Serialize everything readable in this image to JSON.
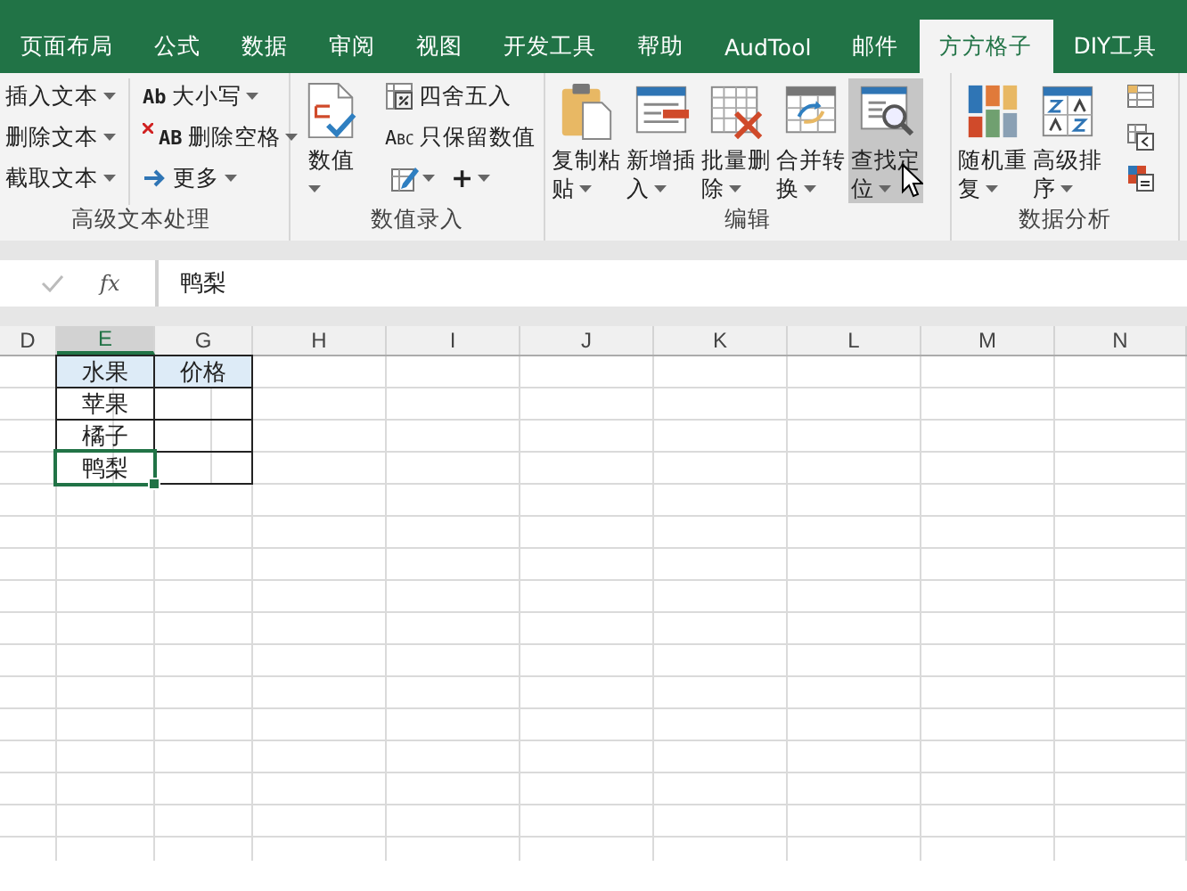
{
  "tabs": [
    {
      "label": "页面布局",
      "selected": false
    },
    {
      "label": "公式",
      "selected": false
    },
    {
      "label": "数据",
      "selected": false
    },
    {
      "label": "审阅",
      "selected": false
    },
    {
      "label": "视图",
      "selected": false
    },
    {
      "label": "开发工具",
      "selected": false
    },
    {
      "label": "帮助",
      "selected": false
    },
    {
      "label": "AudTool",
      "selected": false
    },
    {
      "label": "邮件",
      "selected": false
    },
    {
      "label": "方方格子",
      "selected": true
    },
    {
      "label": "DIY工具",
      "selected": false
    }
  ],
  "ribbon": {
    "groups": [
      {
        "label": "高级文本处理",
        "columns": [
          {
            "kind": "small",
            "items": [
              {
                "label": "插入文本",
                "dropdown": true
              },
              {
                "label": "删除文本",
                "dropdown": true
              },
              {
                "label": "截取文本",
                "dropdown": true
              }
            ]
          },
          {
            "kind": "small",
            "items": [
              {
                "badge": "Ab",
                "label": "大小写",
                "dropdown": true
              },
              {
                "badge": "AB",
                "label": "删除空格",
                "dropdown": true
              },
              {
                "label": "更多",
                "dropdown": true
              }
            ]
          }
        ]
      },
      {
        "label": "数值录入",
        "columns": [
          {
            "kind": "large",
            "items": [
              {
                "lines": [
                  "数值"
                ],
                "dropdown": true,
                "hovered": false,
                "cursor": false
              }
            ]
          },
          {
            "kind": "small",
            "items": [
              {
                "label": "四舍五入",
                "dropdown": false
              },
              {
                "badge": "Abc",
                "label": "只保留数值",
                "dropdown": false
              },
              {
                "buttons": [
                  {
                    "dropdown": true
                  },
                  {
                    "symbol": "+",
                    "dropdown": true
                  }
                ]
              }
            ]
          }
        ]
      },
      {
        "label": "编辑",
        "columns": [
          {
            "kind": "large",
            "items": [
              {
                "lines": [
                  "复制粘",
                  "贴"
                ],
                "dropdown": true,
                "hovered": false,
                "cursor": false
              },
              {
                "lines": [
                  "新增插",
                  "入"
                ],
                "dropdown": true,
                "hovered": false,
                "cursor": false
              },
              {
                "lines": [
                  "批量删",
                  "除"
                ],
                "dropdown": true,
                "hovered": false,
                "cursor": false
              },
              {
                "lines": [
                  "合并转",
                  "换"
                ],
                "dropdown": true,
                "hovered": false,
                "cursor": false
              },
              {
                "lines": [
                  "查找定",
                  "位"
                ],
                "dropdown": true,
                "hovered": true,
                "cursor": true
              }
            ]
          }
        ]
      },
      {
        "label": "数据分析",
        "columns": [
          {
            "kind": "large",
            "items": [
              {
                "lines": [
                  "随机重",
                  "复"
                ],
                "dropdown": true,
                "hovered": false,
                "cursor": false
              },
              {
                "lines": [
                  "高级排",
                  "序"
                ],
                "dropdown": true,
                "hovered": false,
                "cursor": false
              }
            ]
          },
          {
            "kind": "icons",
            "items": [
              {
                "kind": "icon"
              },
              {
                "kind": "icon"
              },
              {
                "kind": "icon"
              }
            ]
          }
        ]
      }
    ]
  },
  "formula_bar": {
    "function_label": "fx",
    "value": "鸭梨"
  },
  "sheet": {
    "columns": [
      {
        "label": "D",
        "selected": false
      },
      {
        "label": "E",
        "selected": true
      },
      {
        "label": "G",
        "selected": false
      },
      {
        "label": "H",
        "selected": false
      },
      {
        "label": "I",
        "selected": false
      },
      {
        "label": "J",
        "selected": false
      },
      {
        "label": "K",
        "selected": false
      },
      {
        "label": "L",
        "selected": false
      },
      {
        "label": "M",
        "selected": false
      },
      {
        "label": "N",
        "selected": false
      }
    ],
    "rows": [
      {
        "cells": [
          {
            "kind": "blank"
          },
          {
            "kind": "header",
            "text": "水果",
            "selected": false
          },
          {
            "kind": "header",
            "text": "价格",
            "selected": false
          }
        ]
      },
      {
        "cells": [
          {
            "kind": "blank"
          },
          {
            "kind": "body",
            "text": "苹果",
            "selected": false
          },
          {
            "kind": "body",
            "selected": false
          }
        ]
      },
      {
        "cells": [
          {
            "kind": "blank"
          },
          {
            "kind": "body",
            "text": "橘子",
            "selected": false
          },
          {
            "kind": "body",
            "selected": false
          }
        ]
      },
      {
        "cells": [
          {
            "kind": "blank"
          },
          {
            "kind": "body",
            "text": "鸭梨",
            "selected": true
          },
          {
            "kind": "body",
            "selected": false
          }
        ]
      }
    ]
  }
}
